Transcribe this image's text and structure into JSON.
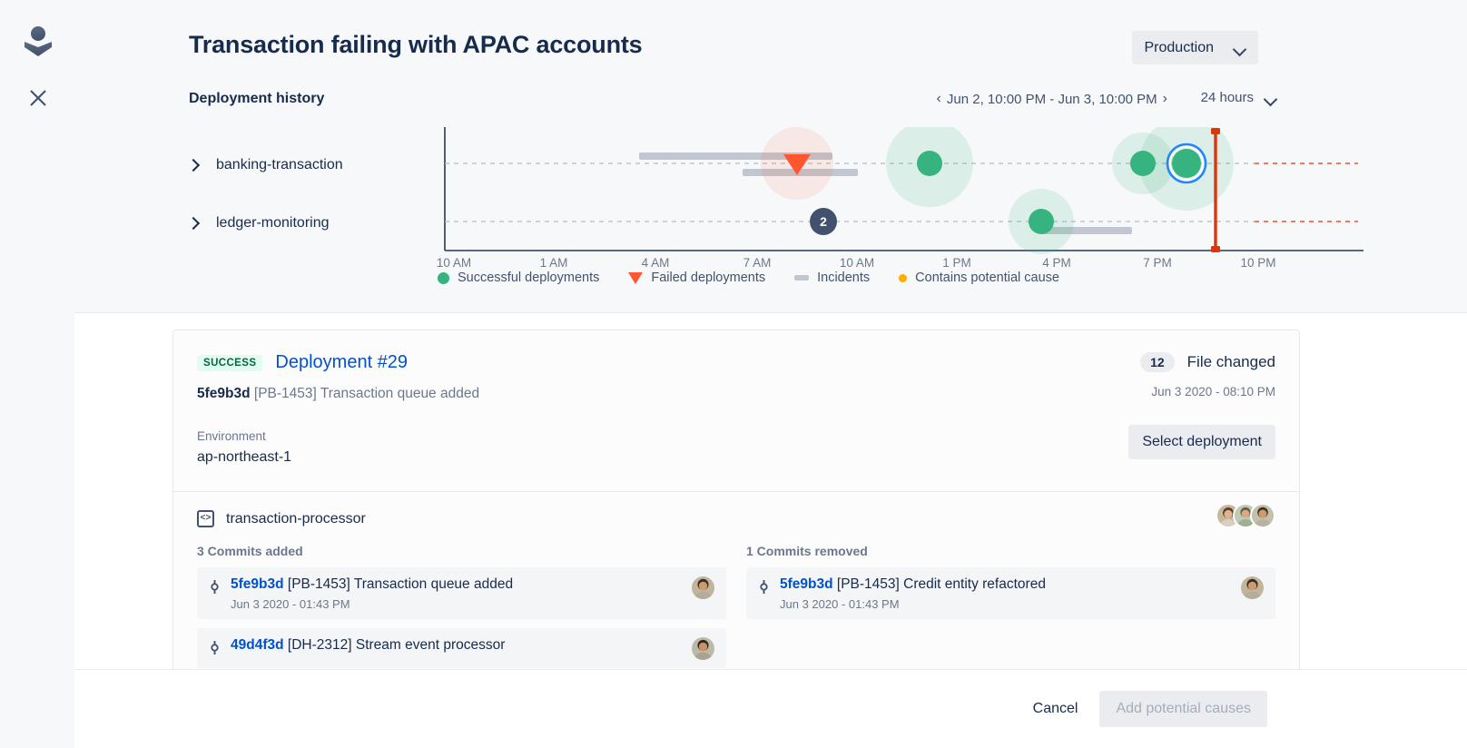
{
  "rail": {
    "avatar_icon": "user-avatar-icon",
    "close_icon": "close-icon"
  },
  "header": {
    "title": "Transaction failing with APAC accounts",
    "environment_selected": "Production",
    "section_title": "Deployment history",
    "date_range": "Jun 2, 10:00 PM - Jun 3, 10:00 PM",
    "prev_arrow": "‹",
    "next_arrow": "›",
    "duration_selected": "24 hours"
  },
  "tree": {
    "items": [
      {
        "label": "banking-transaction"
      },
      {
        "label": "ledger-monitoring"
      }
    ]
  },
  "legend": {
    "items": [
      {
        "label": "Successful deployments",
        "marker": "circle",
        "color": "#36B37E"
      },
      {
        "label": "Failed deployments",
        "marker": "triangle-down",
        "color": "#FF5630"
      },
      {
        "label": "Incidents",
        "marker": "bar",
        "color": "#C1C7D0"
      },
      {
        "label": "Contains potential cause",
        "marker": "dot",
        "color": "#FFAB00"
      }
    ]
  },
  "chart_data": {
    "type": "scatter",
    "title": "Deployment history",
    "xlabel": "",
    "ylabel": "",
    "grid": true,
    "legend_position": "bottom",
    "x_tick_labels": [
      "10 AM",
      "1 AM",
      "4 AM",
      "7 AM",
      "10 AM",
      "1 PM",
      "4 PM",
      "7 PM",
      "10 PM"
    ],
    "x_tick_positions": [
      18,
      128,
      240,
      352,
      462,
      572,
      682,
      793,
      904
    ],
    "lanes": [
      {
        "name": "banking-transaction",
        "y": 40
      },
      {
        "name": "ledger-monitoring",
        "y": 104
      }
    ],
    "series": [
      {
        "name": "Successful deployments",
        "color": "#36B37E",
        "points": [
          {
            "x_label": "1 PM",
            "x": 542,
            "lane": 0,
            "halo": 48,
            "r": 14,
            "selected": false
          },
          {
            "x_label": "7 PM",
            "x": 777,
            "lane": 0,
            "halo": 34,
            "r": 14,
            "selected": false
          },
          {
            "x_label": "8:10 PM",
            "x": 825,
            "lane": 0,
            "halo": 52,
            "r": 16,
            "selected": true
          },
          {
            "x_label": "4 PM",
            "x": 665,
            "lane": 1,
            "halo": 36,
            "r": 14,
            "selected": false
          }
        ]
      },
      {
        "name": "Failed deployments",
        "color": "#FF5630",
        "points": [
          {
            "x_label": "8:30 AM",
            "x": 396,
            "lane": 0,
            "halo": 40
          }
        ]
      },
      {
        "name": "Incidents",
        "color": "#C1C7D0",
        "bars": [
          {
            "lane": 0,
            "offset": -8,
            "x_start": 222,
            "x_end": 435
          },
          {
            "lane": 0,
            "offset": 10,
            "x_start": 336,
            "x_end": 463
          },
          {
            "lane": 1,
            "offset": 10,
            "x_start": 665,
            "x_end": 765
          }
        ]
      }
    ],
    "annotations": [
      {
        "type": "count-badge",
        "label": "2",
        "x": 425,
        "lane": 1
      },
      {
        "type": "selection-marker",
        "color": "#DE350B",
        "x": 857
      }
    ]
  },
  "deployment": {
    "status_badge": "SUCCESS",
    "title": "Deployment #29",
    "commit_sha": "5fe9b3d",
    "commit_message": "[PB-1453] Transaction queue added",
    "environment_label": "Environment",
    "environment_value": "ap-northeast-1",
    "files_count": "12",
    "files_label": "File changed",
    "date": "Jun 3 2020 - 08:10 PM",
    "select_button": "Select deployment"
  },
  "repo": {
    "name": "transaction-processor",
    "added_header": "3 Commits added",
    "removed_header": "1 Commits removed",
    "commits_added": [
      {
        "sha": "5fe9b3d",
        "message": "[PB-1453] Transaction queue added",
        "date": "Jun 3 2020 - 01:43 PM"
      },
      {
        "sha": "49d4f3d",
        "message": "[DH-2312] Stream event processor",
        "date": ""
      }
    ],
    "commits_removed": [
      {
        "sha": "5fe9b3d",
        "message": "[PB-1453] Credit entity refactored",
        "date": "Jun 3 2020 - 01:43 PM"
      }
    ]
  },
  "footer": {
    "cancel_label": "Cancel",
    "primary_label": "Add potential causes"
  },
  "colors": {
    "success": "#36B37E",
    "failure": "#FF5630",
    "incident": "#C1C7D0",
    "potential_cause": "#FFAB00",
    "link": "#0052CC",
    "selection": "#DE350B",
    "selected_ring": "#2684FF"
  }
}
